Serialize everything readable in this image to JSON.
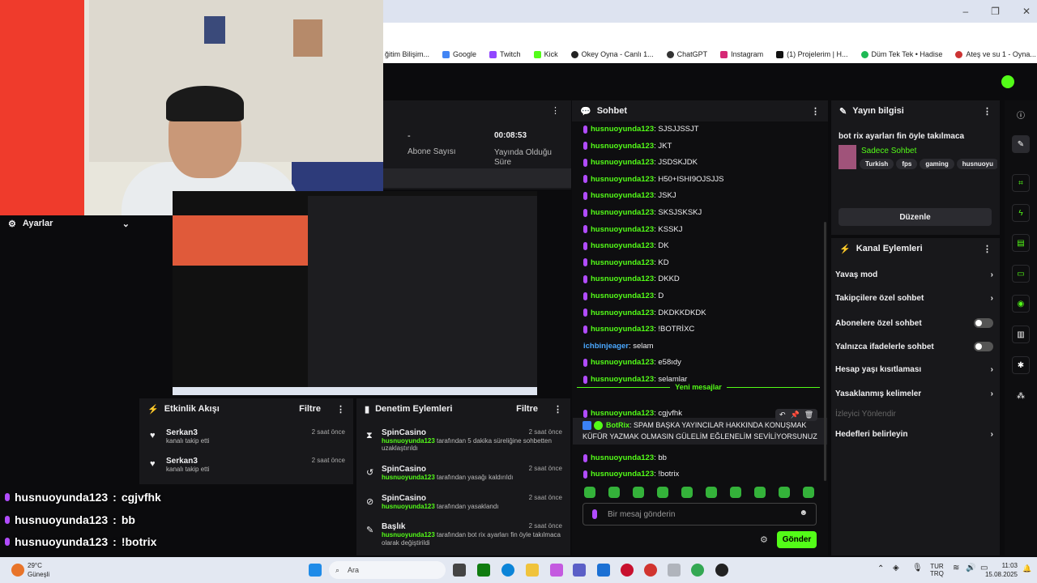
{
  "browser": {
    "bookmarks": [
      "ğitim Bilişim...",
      "Google",
      "Twitch",
      "Kick",
      "Okey Oyna - Canlı 1...",
      "ChatGPT",
      "Instagram",
      "(1) Projelerim | H...",
      "Düm Tek Tek • Hadise",
      "Ateş ve su 1 - Oyna..."
    ],
    "colors": {
      "accent": "#53fc18",
      "bg": "#0e0e10",
      "panel": "#18181b"
    }
  },
  "stats": {
    "dash": "-",
    "abone_label": "Abone Sayısı",
    "time": "00:08:53",
    "time_label": "Yayında Olduğu Süre"
  },
  "ayarlar": {
    "title": "Ayarlar"
  },
  "etkinlik": {
    "title": "Etkinlik Akışı",
    "filter": "Filtre",
    "items": [
      {
        "name": "Serkan3",
        "sub": "kanalı takip etti",
        "time": "2 saat önce"
      },
      {
        "name": "Serkan3",
        "sub": "kanalı takip etti",
        "time": "2 saat önce"
      }
    ]
  },
  "overlay": [
    {
      "user": "husnuoyunda123",
      "sep": ":",
      "msg": "cgjvfhk"
    },
    {
      "user": "husnuoyunda123",
      "sep": ":",
      "msg": "bb"
    },
    {
      "user": "husnuoyunda123",
      "sep": ":",
      "msg": "!botrix"
    }
  ],
  "denetim": {
    "title": "Denetim Eylemleri",
    "filter": "Filtre",
    "items": [
      {
        "name": "SpinCasino",
        "time": "2 saat önce",
        "user": "husnuoyunda123",
        "rest": "tarafından 5 dakika süreliğine sohbetten uzaklaştırıldı"
      },
      {
        "name": "SpinCasino",
        "time": "2 saat önce",
        "user": "husnuoyunda123",
        "rest": "tarafından yasağı kaldırıldı"
      },
      {
        "name": "SpinCasino",
        "time": "2 saat önce",
        "user": "husnuoyunda123",
        "rest": "tarafından yasaklandı"
      },
      {
        "name": "Başlık",
        "time": "2 saat önce",
        "user": "husnuoyunda123",
        "rest": "tarafından bot rix ayarları fin öyle takılmaca olarak değiştirildi"
      }
    ]
  },
  "chat": {
    "title": "Sohbet",
    "messages": [
      {
        "u": "husnuoyunda123",
        "t": ": SJSJJSSJT"
      },
      {
        "u": "husnuoyunda123",
        "t": ": JKT"
      },
      {
        "u": "husnuoyunda123",
        "t": ": JSDSKJDK"
      },
      {
        "u": "husnuoyunda123",
        "t": ": H50+ISHI9OJSJJS"
      },
      {
        "u": "husnuoyunda123",
        "t": ": JSKJ"
      },
      {
        "u": "husnuoyunda123",
        "t": ": SKSJSKSKJ"
      },
      {
        "u": "husnuoyunda123",
        "t": ": KSSKJ"
      },
      {
        "u": "husnuoyunda123",
        "t": ": DK"
      },
      {
        "u": "husnuoyunda123",
        "t": ": KD"
      },
      {
        "u": "husnuoyunda123",
        "t": ": DKKD"
      },
      {
        "u": "husnuoyunda123",
        "t": ": D"
      },
      {
        "u": "husnuoyunda123",
        "t": ": DKDKKDKDK"
      },
      {
        "u": "husnuoyunda123",
        "t": ": !BOTRİXC"
      },
      {
        "u": "ichbinjeager",
        "t": ": selam"
      },
      {
        "u": "husnuoyunda123",
        "t": ": e58ıdy"
      },
      {
        "u": "husnuoyunda123",
        "t": ": selamlar"
      }
    ],
    "new_label": "Yeni mesajlar",
    "after": [
      {
        "u": "husnuoyunda123",
        "t": ": cgjvfhk"
      },
      {
        "u": "husnuoyunda123",
        "t": ": bb"
      },
      {
        "u": "husnuoyunda123",
        "t": ": !botrix"
      }
    ],
    "botrix": {
      "u": "BotRix",
      "line1": ": SPAM BAŞKA YAYINCILAR HAKKINDA KONUŞMAK",
      "line2": "KÜFÜR YAZMAK OLMASIN GÜLELİM EĞLENELİM SEVİLİYORSUNUZ"
    },
    "placeholder": "Bir mesaj gönderin",
    "send": "Gönder"
  },
  "info": {
    "title": "Yayın bilgisi",
    "stream_title": "bot rix ayarları fin öyle takılmaca",
    "category": "Sadece Sohbet",
    "tags": [
      "Turkish",
      "fps",
      "gaming",
      "husnuoyu"
    ],
    "edit": "Düzenle"
  },
  "kanal": {
    "title": "Kanal Eylemleri",
    "rows": [
      "Yavaş mod",
      "Takipçilere özel sohbet",
      "Abonelere özel sohbet",
      "Yalnızca ifadelerle sohbet",
      "Hesap yaşı kısıtlaması",
      "Yasaklanmış kelimeler"
    ],
    "follower_label": "İzleyici Yönlendir",
    "target": "Hedefleri belirleyin"
  },
  "taskbar": {
    "weather_temp": "29°C",
    "weather_desc": "Güneşli",
    "search": "Ara",
    "lang1": "TUR",
    "lang2": "TRQ",
    "time": "11:03",
    "date": "15.08.2025"
  }
}
